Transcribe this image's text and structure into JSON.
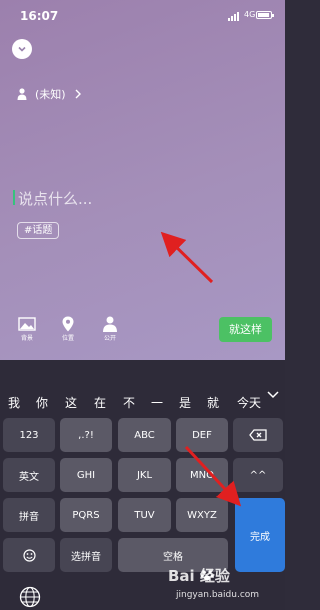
{
  "status_bar": {
    "time": "16:07",
    "network": "4G"
  },
  "compose": {
    "collapse_icon": "chevron-down-icon",
    "visibility_label": "(未知)",
    "input_placeholder": "说点什么...",
    "topic_chip": "#话题",
    "tools": [
      {
        "icon": "image-icon",
        "label": "背景"
      },
      {
        "icon": "location-pin-icon",
        "label": "位置"
      },
      {
        "icon": "person-icon",
        "label": "公开"
      }
    ],
    "send_label": "就这样",
    "send_color": "#4cc164"
  },
  "keyboard": {
    "candidates": [
      "我",
      "你",
      "这",
      "在",
      "不",
      "一",
      "是",
      "就",
      "今天"
    ],
    "rows": [
      [
        "123",
        ",.?!",
        "ABC",
        "DEF",
        "delete"
      ],
      [
        "英文",
        "GHI",
        "JKL",
        "MNO",
        "^^"
      ],
      [
        "拼音",
        "PQRS",
        "TUV",
        "WXYZ",
        "完成"
      ],
      [
        "emoji",
        "选拼音",
        "空格"
      ]
    ],
    "done_color": "#2f7bdc"
  },
  "watermark": {
    "brand": "Bai 经验",
    "url": "jingyan.baidu.com"
  }
}
